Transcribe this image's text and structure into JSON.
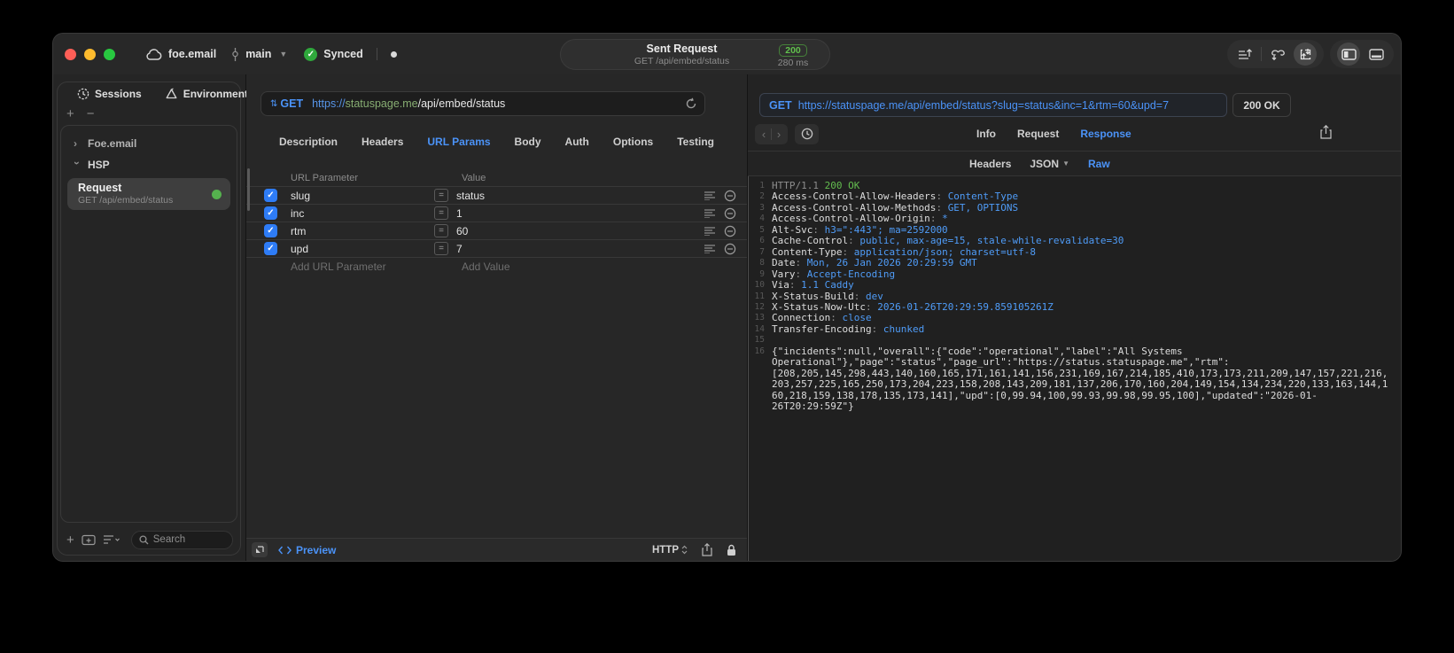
{
  "titlebar": {
    "cloud_label": "foe.email",
    "branch": "main",
    "sync_label": "Synced",
    "pill": {
      "title": "Sent Request",
      "subtitle": "GET /api/embed/status",
      "status_code": "200",
      "duration": "280 ms"
    }
  },
  "sidebar": {
    "tabs": [
      {
        "label": "Sessions",
        "icon": "clock-icon"
      },
      {
        "label": "Environments",
        "icon": "environments-icon"
      }
    ],
    "tree": [
      {
        "label": "Foe.email",
        "state": "collapsed"
      },
      {
        "label": "HSP",
        "state": "expanded"
      }
    ],
    "request_item": {
      "title": "Request",
      "subtitle": "GET /api/embed/status"
    },
    "search_placeholder": "Search"
  },
  "request_panel": {
    "method": "GET",
    "url_scheme": "https://",
    "url_host": "statuspage.me",
    "url_path": "/api/embed/status",
    "tabs": [
      "Description",
      "Headers",
      "URL Params",
      "Body",
      "Auth",
      "Options",
      "Testing"
    ],
    "active_tab": "URL Params",
    "table": {
      "columns": [
        "URL Parameter",
        "Value"
      ],
      "rows": [
        {
          "name": "slug",
          "value": "status",
          "checked": true
        },
        {
          "name": "inc",
          "value": "1",
          "checked": true
        },
        {
          "name": "rtm",
          "value": "60",
          "checked": true
        },
        {
          "name": "upd",
          "value": "7",
          "checked": true
        }
      ],
      "add_name_placeholder": "Add URL Parameter",
      "add_value_placeholder": "Add Value"
    },
    "footer": {
      "preview_label": "Preview",
      "http_label": "HTTP"
    }
  },
  "response_panel": {
    "method": "GET",
    "url": "https://statuspage.me/api/embed/status?slug=status&inc=1&rtm=60&upd=7",
    "status": "200 OK",
    "tabs": [
      "Info",
      "Request",
      "Response"
    ],
    "active_tab": "Response",
    "subtabs": [
      {
        "label": "Headers",
        "dropdown": false
      },
      {
        "label": "JSON",
        "dropdown": true
      },
      {
        "label": "Raw",
        "dropdown": false
      }
    ],
    "active_subtab": "Raw",
    "code": {
      "lines": [
        {
          "n": "1",
          "seg": [
            [
              "cd-dim",
              "HTTP/1.1 "
            ],
            [
              "cd-green",
              "200 OK"
            ]
          ]
        },
        {
          "n": "2",
          "seg": [
            [
              "cd-key",
              "Access-Control-Allow-Headers"
            ],
            [
              "cd-dim",
              ": "
            ],
            [
              "cd-val",
              "Content-Type"
            ]
          ]
        },
        {
          "n": "3",
          "seg": [
            [
              "cd-key",
              "Access-Control-Allow-Methods"
            ],
            [
              "cd-dim",
              ": "
            ],
            [
              "cd-val",
              "GET, OPTIONS"
            ]
          ]
        },
        {
          "n": "4",
          "seg": [
            [
              "cd-key",
              "Access-Control-Allow-Origin"
            ],
            [
              "cd-dim",
              ": "
            ],
            [
              "cd-val",
              "*"
            ]
          ]
        },
        {
          "n": "5",
          "seg": [
            [
              "cd-key",
              "Alt-Svc"
            ],
            [
              "cd-dim",
              ": "
            ],
            [
              "cd-val",
              "h3=\":443\"; ma=2592000"
            ]
          ]
        },
        {
          "n": "6",
          "seg": [
            [
              "cd-key",
              "Cache-Control"
            ],
            [
              "cd-dim",
              ": "
            ],
            [
              "cd-val",
              "public, max-age=15, stale-while-revalidate=30"
            ]
          ]
        },
        {
          "n": "7",
          "seg": [
            [
              "cd-key",
              "Content-Type"
            ],
            [
              "cd-dim",
              ": "
            ],
            [
              "cd-val",
              "application/json; charset=utf-8"
            ]
          ]
        },
        {
          "n": "8",
          "seg": [
            [
              "cd-key",
              "Date"
            ],
            [
              "cd-dim",
              ": "
            ],
            [
              "cd-val",
              "Mon, 26 Jan 2026 20:29:59 GMT"
            ]
          ]
        },
        {
          "n": "9",
          "seg": [
            [
              "cd-key",
              "Vary"
            ],
            [
              "cd-dim",
              ": "
            ],
            [
              "cd-val",
              "Accept-Encoding"
            ]
          ]
        },
        {
          "n": "10",
          "seg": [
            [
              "cd-key",
              "Via"
            ],
            [
              "cd-dim",
              ": "
            ],
            [
              "cd-val",
              "1.1 Caddy"
            ]
          ]
        },
        {
          "n": "11",
          "seg": [
            [
              "cd-key",
              "X-Status-Build"
            ],
            [
              "cd-dim",
              ": "
            ],
            [
              "cd-val",
              "dev"
            ]
          ]
        },
        {
          "n": "12",
          "seg": [
            [
              "cd-key",
              "X-Status-Now-Utc"
            ],
            [
              "cd-dim",
              ": "
            ],
            [
              "cd-val",
              "2026-01-26T20:29:59.859105261Z"
            ]
          ]
        },
        {
          "n": "13",
          "seg": [
            [
              "cd-key",
              "Connection"
            ],
            [
              "cd-dim",
              ": "
            ],
            [
              "cd-val",
              "close"
            ]
          ]
        },
        {
          "n": "14",
          "seg": [
            [
              "cd-key",
              "Transfer-Encoding"
            ],
            [
              "cd-dim",
              ": "
            ],
            [
              "cd-val",
              "chunked"
            ]
          ]
        },
        {
          "n": "15",
          "seg": []
        },
        {
          "n": "16",
          "seg": [
            [
              "cd-key",
              "{\"incidents\":null,\"overall\":{\"code\":\"operational\",\"label\":\"All Systems Operational\"},\"page\":\"status\",\"page_url\":\"https://status.statuspage.me\",\"rtm\":[208,205,145,298,443,140,160,165,171,161,141,156,231,169,167,214,185,410,173,173,211,209,147,157,221,216,203,257,225,165,250,173,204,223,158,208,143,209,181,137,206,170,160,204,149,154,134,234,220,133,163,144,160,218,159,138,178,135,173,141],\"upd\":[0,99.94,100,99.93,99.98,99.95,100],\"updated\":\"2026-01-26T20:29:59Z\"}"
            ]
          ]
        }
      ]
    }
  },
  "colors": {
    "accent_blue": "#4b93f8",
    "status_green": "#61c14c",
    "host_green": "#87ad72",
    "checkbox_blue": "#2e7cf6"
  }
}
